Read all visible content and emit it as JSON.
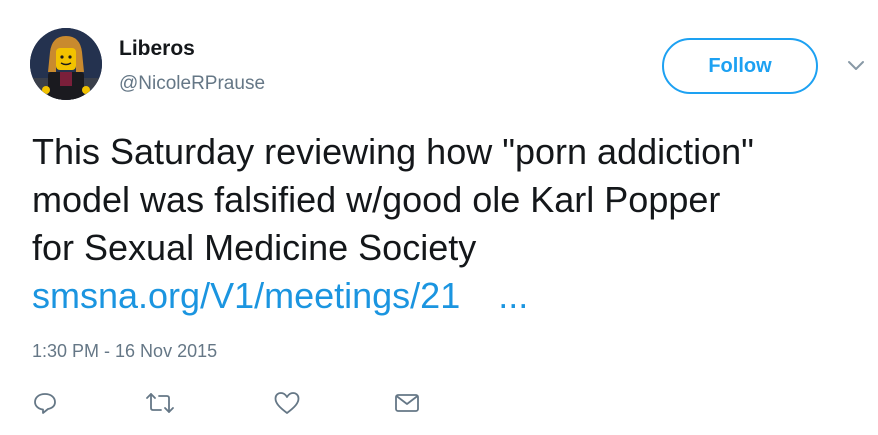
{
  "author": {
    "display_name": "Liberos",
    "handle": "@NicoleRPrause",
    "avatar_icon": "lego-minifigure-avatar"
  },
  "follow_button": {
    "label": "Follow"
  },
  "menu": {
    "icon": "chevron-down-icon"
  },
  "tweet": {
    "lines": [
      "This Saturday reviewing how \"porn addiction\"",
      "model was falsified w/good ole Karl Popper",
      "for Sexual Medicine Society"
    ],
    "link_text": "smsna.org/V1/meetings/21",
    "link_ellipsis": "...",
    "timestamp": "1:30 PM - 16 Nov 2015"
  },
  "actions": [
    {
      "icon": "reply-icon"
    },
    {
      "icon": "retweet-icon"
    },
    {
      "icon": "like-heart-icon"
    },
    {
      "icon": "direct-message-icon"
    }
  ],
  "colors": {
    "accent": "#1da1f2",
    "link": "#1b95e0",
    "text": "#14171a",
    "secondary": "#657786"
  }
}
